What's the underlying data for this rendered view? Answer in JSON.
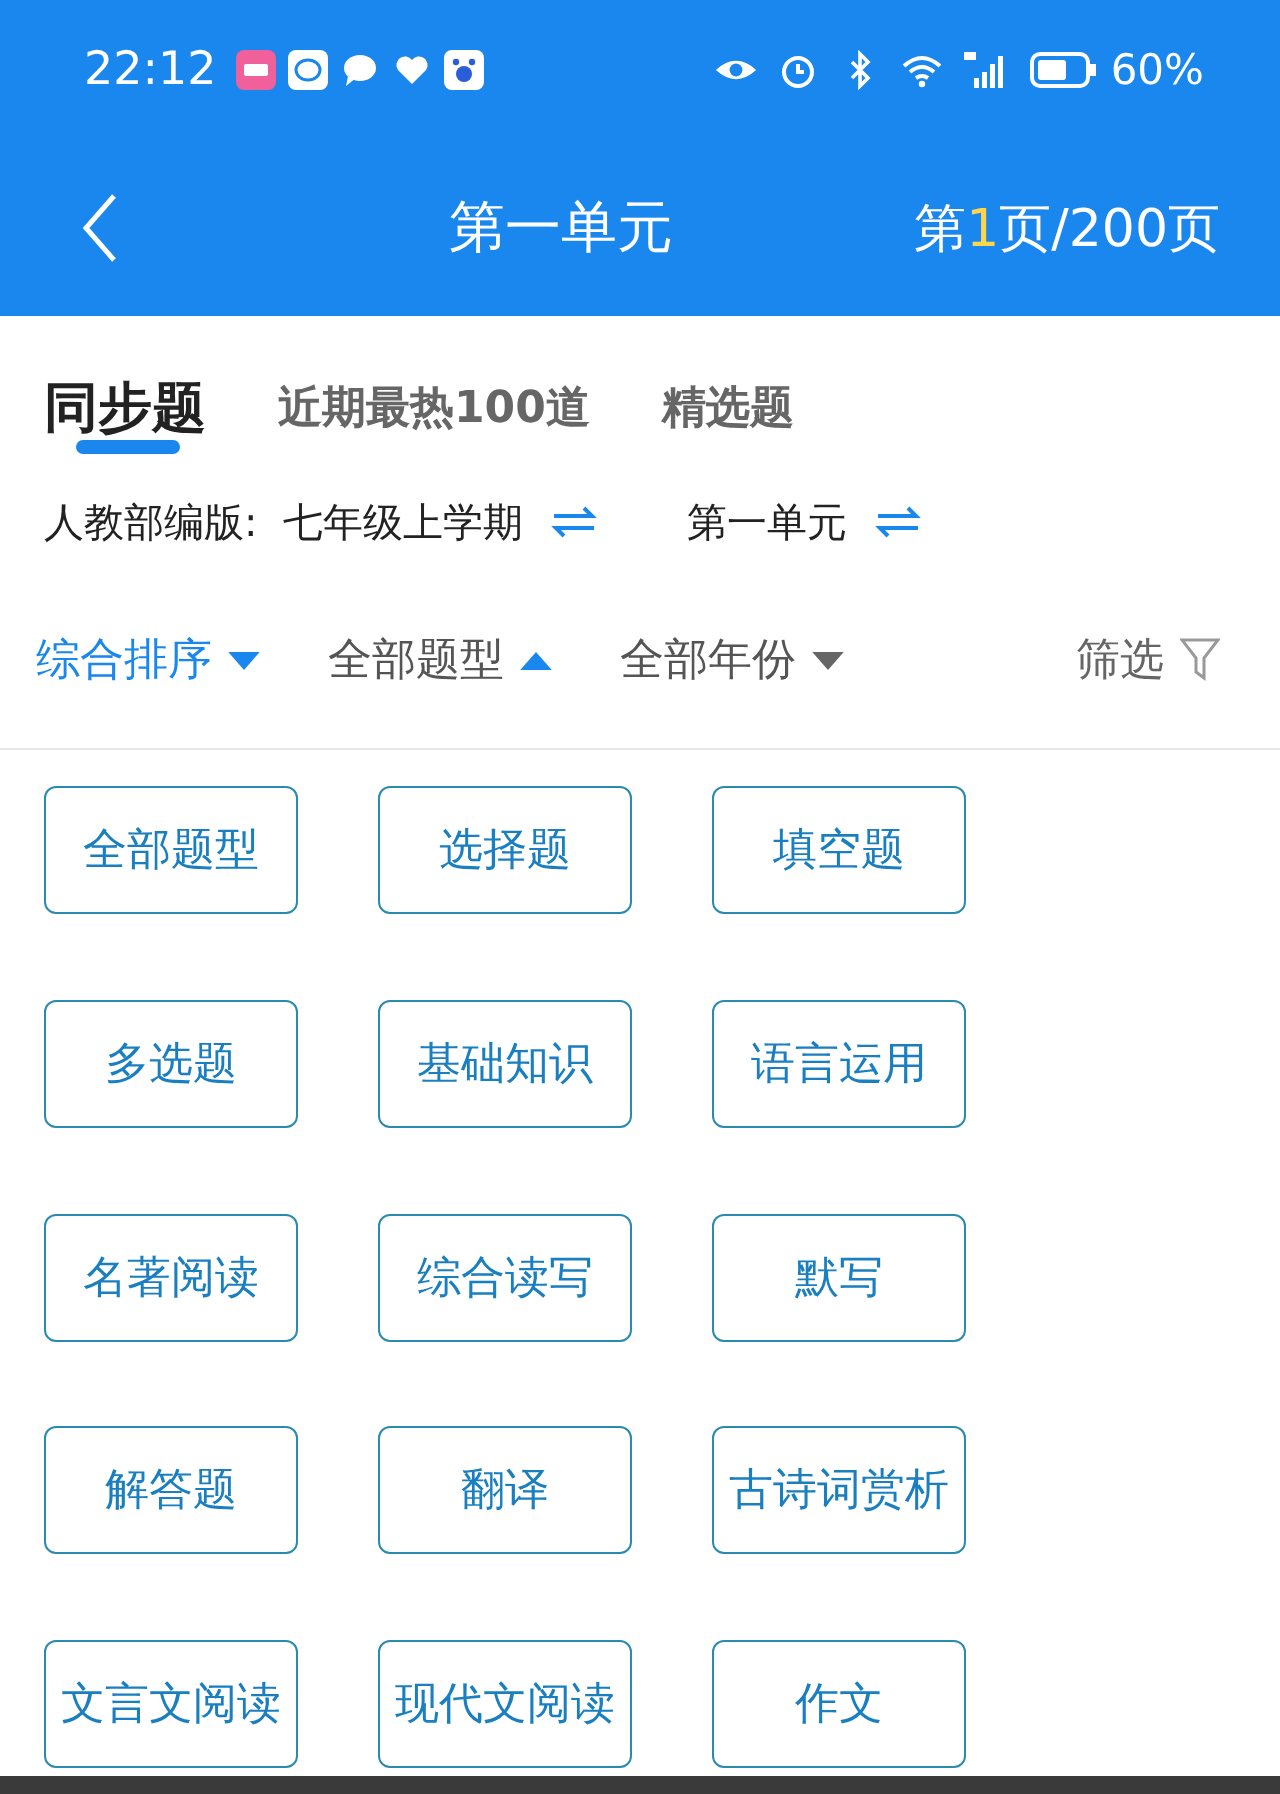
{
  "status_bar": {
    "time": "22:12",
    "battery_text": "60%"
  },
  "header": {
    "title": "第一单元",
    "page_indicator": {
      "prefix": "第",
      "current": "1",
      "suffix": "页/200页"
    }
  },
  "tabs": [
    {
      "label": "同步题",
      "selected": true
    },
    {
      "label": "近期最热100道",
      "selected": false
    },
    {
      "label": "精选题",
      "selected": false
    }
  ],
  "edition": {
    "book": "人教部编版:  七年级上学期",
    "unit": "第一单元"
  },
  "filters": [
    {
      "kind": "dropdown",
      "label": "综合排序",
      "selected": true,
      "expanded": false
    },
    {
      "kind": "dropdown",
      "label": "全部题型",
      "selected": false,
      "expanded": true
    },
    {
      "kind": "dropdown",
      "label": "全部年份",
      "selected": false,
      "expanded": false
    },
    {
      "kind": "filter",
      "label": "筛选",
      "selected": false,
      "expanded": false
    }
  ],
  "question_types": [
    "全部题型",
    "选择题",
    "填空题",
    "多选题",
    "基础知识",
    "语言运用",
    "名著阅读",
    "综合读写",
    "默写",
    "解答题",
    "翻译",
    "古诗词赏析",
    "文言文阅读",
    "现代文阅读",
    "作文"
  ]
}
